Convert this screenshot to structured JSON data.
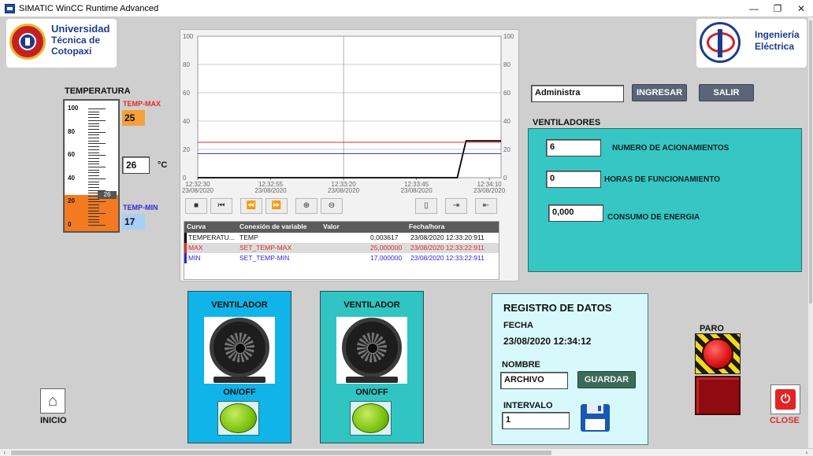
{
  "window": {
    "title": "SIMATIC WinCC Runtime Advanced",
    "minimize": "—",
    "restore": "❐",
    "close": "✕"
  },
  "logo_left": {
    "line1": "Universidad",
    "line2": "Técnica de",
    "line3": "Cotopaxi"
  },
  "logo_right": {
    "line1": "Ingeniería",
    "line2": "Eléctrica"
  },
  "thermometer": {
    "title": "TEMPERATURA",
    "ticks": [
      "100",
      "80",
      "60",
      "40",
      "20",
      "0"
    ],
    "current_tag": "26",
    "fill_level_fraction": 0.26,
    "max_label": "TEMP-MAX",
    "max_value": "25",
    "min_label": "TEMP-MIN",
    "min_value": "17",
    "temp_value": "26",
    "unit": "°C",
    "colors": {
      "fill": "#f37a20",
      "max": "#e02b2b",
      "min": "#2b2bd9"
    }
  },
  "chart_data": {
    "type": "line",
    "y_left_ticks": [
      "100",
      "80",
      "60",
      "40",
      "20",
      "0"
    ],
    "y_right_ticks": [
      "100",
      "80",
      "60",
      "40",
      "20",
      "0"
    ],
    "ylim": [
      0,
      100
    ],
    "x_ticks": [
      {
        "time": "12:32:30",
        "date": "23/08/2020"
      },
      {
        "time": "12:32:55",
        "date": "23/08/2020"
      },
      {
        "time": "12:33:20",
        "date": "23/08/2020"
      },
      {
        "time": "12:33:45",
        "date": "23/08/2020"
      },
      {
        "time": "12:34:10",
        "date": "23/08/2020"
      }
    ],
    "x_range_seconds": [
      0,
      104
    ],
    "series": [
      {
        "name": "TEMPERATU...",
        "color": "#000000",
        "points": [
          [
            0,
            0
          ],
          [
            89,
            0
          ],
          [
            92,
            26
          ],
          [
            104,
            26
          ]
        ]
      },
      {
        "name": "MAX",
        "color": "#e02b2b",
        "points": [
          [
            0,
            25
          ],
          [
            104,
            25
          ]
        ]
      },
      {
        "name": "MIN",
        "color": "#2b2bd9",
        "points": [
          [
            0,
            17
          ],
          [
            104,
            17
          ]
        ]
      }
    ],
    "cursor_x_seconds": 50
  },
  "trend_toolbar": {
    "buttons": [
      "■",
      "⏮",
      "⏪",
      "⏩",
      "⊕",
      "⊖",
      "▯",
      "⇥",
      "⇤"
    ]
  },
  "legend_table": {
    "headers": [
      "Curva",
      "Conexión de variable",
      "Valor",
      "Fecha/hora"
    ],
    "rows": [
      {
        "curve": "TEMPERATU...",
        "tag": "TEMP",
        "value": "0,003617",
        "datetime": "23/08/2020 12:33:20:911",
        "color": "#000000"
      },
      {
        "curve": "MAX",
        "tag": "SET_TEMP-MAX",
        "value": "25,000000",
        "datetime": "23/08/2020 12:33:22:911",
        "color": "#e02b2b"
      },
      {
        "curve": "MIN",
        "tag": "SET_TEMP-MIN",
        "value": "17,000000",
        "datetime": "23/08/2020 12:33:22:911",
        "color": "#2b2bd9"
      }
    ]
  },
  "login": {
    "user_value": "Administra",
    "login_button": "INGRESAR",
    "logout_button": "SALIR"
  },
  "ventiladores": {
    "title": "VENTILADORES",
    "rows": [
      {
        "value": "6",
        "label": "NUMERO DE ACIONAMIENTOS"
      },
      {
        "value": "0",
        "label": "HORAS DE FUNCIONAMIENTO"
      },
      {
        "value": "0,000",
        "label": "CONSUMO DE ENERGIA"
      }
    ]
  },
  "fan1": {
    "title": "VENTILADOR",
    "switch_label": "ON/OFF",
    "bg": "#11b4e8"
  },
  "fan2": {
    "title": "VENTILADOR",
    "switch_label": "ON/OFF",
    "bg": "#30c5c3"
  },
  "registro": {
    "title": "REGISTRO DE DATOS",
    "date_label": "FECHA",
    "date_value": "23/08/2020 12:34:12",
    "name_label": "NOMBRE",
    "name_value": "ARCHIVO",
    "save_button": "GUARDAR",
    "interval_label": "INTERVALO",
    "interval_value": "1"
  },
  "paro": {
    "label": "PARO"
  },
  "nav": {
    "home_label": "INICIO",
    "close_label": "CLOSE"
  }
}
